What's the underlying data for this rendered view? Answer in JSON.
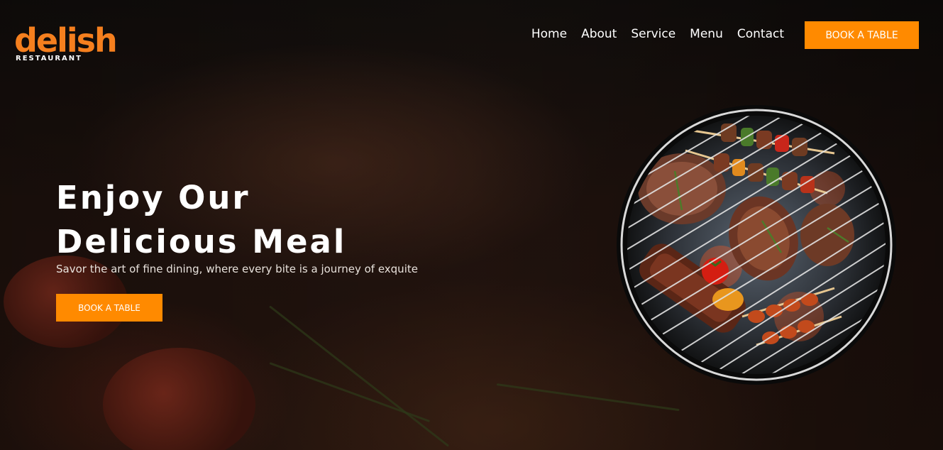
{
  "logo": {
    "word": "delish",
    "sub": "RESTAURANT"
  },
  "nav": {
    "items": [
      "Home",
      "About",
      "Service",
      "Menu",
      "Contact"
    ]
  },
  "header": {
    "cta_label": "BOOK A TABLE"
  },
  "hero": {
    "title_line1": "Enjoy Our",
    "title_line2": "Delicious Meal",
    "subtitle": "Savor the art of fine dining, where every bite is a journey of exquite",
    "cta_label": "BOOK A TABLE"
  },
  "colors": {
    "accent": "#ff8a00",
    "logo": "#f57f1e",
    "text": "#ffffff"
  },
  "icons": {
    "hero_image": "bbq-grill-image"
  }
}
